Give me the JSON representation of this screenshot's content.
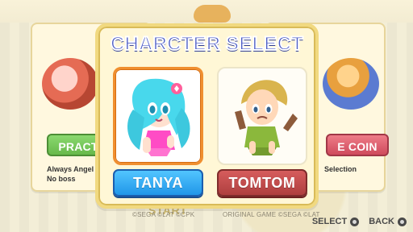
{
  "modal": {
    "title": "CHARCTER SELECT",
    "characters": [
      {
        "name": "TANYA"
      },
      {
        "name": "TOMTOM"
      }
    ]
  },
  "background": {
    "left_card": {
      "button_label": "PRACT",
      "info_lines": [
        "Always Angel",
        "No boss"
      ]
    },
    "right_card": {
      "button_label": "E COIN",
      "info_lines": [
        "Selection"
      ]
    },
    "start_label": "START",
    "copyright_left": "©SEGA ©LAT ©CPK",
    "copyright_right": "ORIGINAL GAME ©SEGA ©LAT"
  },
  "controls": {
    "select_label": "SELECT",
    "back_label": "BACK"
  },
  "colors": {
    "title_blue": "#4f5fc6",
    "selected_border": "#f08f2f",
    "tanya_button": "#2096e8",
    "tomtom_button": "#ae3f3f"
  }
}
